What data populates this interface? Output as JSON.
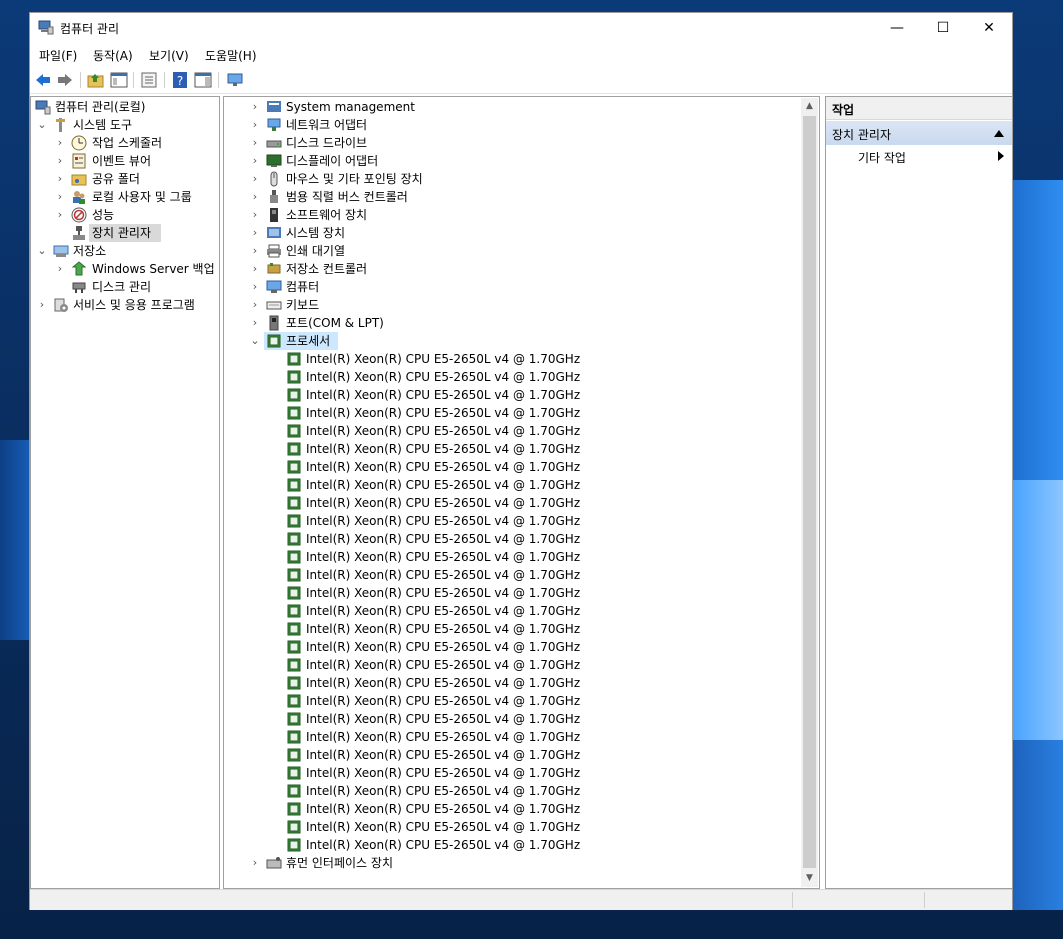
{
  "window": {
    "title": "컴퓨터 관리",
    "controls": {
      "minimize": "—",
      "maximize": "☐",
      "close": "✕"
    }
  },
  "menu": [
    "파일(F)",
    "동작(A)",
    "보기(V)",
    "도움말(H)"
  ],
  "left_tree": {
    "root": "컴퓨터 관리(로컬)",
    "system_tools": {
      "label": "시스템 도구",
      "children": [
        "작업 스케줄러",
        "이벤트 뷰어",
        "공유 폴더",
        "로컬 사용자 및 그룹",
        "성능",
        "장치 관리자"
      ]
    },
    "storage": {
      "label": "저장소",
      "children": [
        "Windows Server 백업",
        "디스크 관리"
      ]
    },
    "services": "서비스 및 응용 프로그램"
  },
  "device_tree": {
    "categories_before": [
      "System management",
      "네트워크 어댑터",
      "디스크 드라이브",
      "디스플레이 어댑터",
      "마우스 및 기타 포인팅 장치",
      "범용 직렬 버스 컨트롤러",
      "소프트웨어 장치",
      "시스템 장치",
      "인쇄 대기열",
      "저장소 컨트롤러",
      "컴퓨터",
      "키보드",
      "포트(COM & LPT)"
    ],
    "processor_category": "프로세서",
    "processors": [
      "Intel(R) Xeon(R) CPU E5-2650L v4 @ 1.70GHz",
      "Intel(R) Xeon(R) CPU E5-2650L v4 @ 1.70GHz",
      "Intel(R) Xeon(R) CPU E5-2650L v4 @ 1.70GHz",
      "Intel(R) Xeon(R) CPU E5-2650L v4 @ 1.70GHz",
      "Intel(R) Xeon(R) CPU E5-2650L v4 @ 1.70GHz",
      "Intel(R) Xeon(R) CPU E5-2650L v4 @ 1.70GHz",
      "Intel(R) Xeon(R) CPU E5-2650L v4 @ 1.70GHz",
      "Intel(R) Xeon(R) CPU E5-2650L v4 @ 1.70GHz",
      "Intel(R) Xeon(R) CPU E5-2650L v4 @ 1.70GHz",
      "Intel(R) Xeon(R) CPU E5-2650L v4 @ 1.70GHz",
      "Intel(R) Xeon(R) CPU E5-2650L v4 @ 1.70GHz",
      "Intel(R) Xeon(R) CPU E5-2650L v4 @ 1.70GHz",
      "Intel(R) Xeon(R) CPU E5-2650L v4 @ 1.70GHz",
      "Intel(R) Xeon(R) CPU E5-2650L v4 @ 1.70GHz",
      "Intel(R) Xeon(R) CPU E5-2650L v4 @ 1.70GHz",
      "Intel(R) Xeon(R) CPU E5-2650L v4 @ 1.70GHz",
      "Intel(R) Xeon(R) CPU E5-2650L v4 @ 1.70GHz",
      "Intel(R) Xeon(R) CPU E5-2650L v4 @ 1.70GHz",
      "Intel(R) Xeon(R) CPU E5-2650L v4 @ 1.70GHz",
      "Intel(R) Xeon(R) CPU E5-2650L v4 @ 1.70GHz",
      "Intel(R) Xeon(R) CPU E5-2650L v4 @ 1.70GHz",
      "Intel(R) Xeon(R) CPU E5-2650L v4 @ 1.70GHz",
      "Intel(R) Xeon(R) CPU E5-2650L v4 @ 1.70GHz",
      "Intel(R) Xeon(R) CPU E5-2650L v4 @ 1.70GHz",
      "Intel(R) Xeon(R) CPU E5-2650L v4 @ 1.70GHz",
      "Intel(R) Xeon(R) CPU E5-2650L v4 @ 1.70GHz",
      "Intel(R) Xeon(R) CPU E5-2650L v4 @ 1.70GHz",
      "Intel(R) Xeon(R) CPU E5-2650L v4 @ 1.70GHz"
    ],
    "categories_after": [
      "휴먼 인터페이스 장치"
    ]
  },
  "actions_pane": {
    "header": "작업",
    "section": "장치 관리자",
    "item": "기타 작업"
  },
  "colors": {
    "selection": "#cce8ff",
    "tree_selected": "#d9d9d9",
    "chip": "#3f8f3f"
  }
}
